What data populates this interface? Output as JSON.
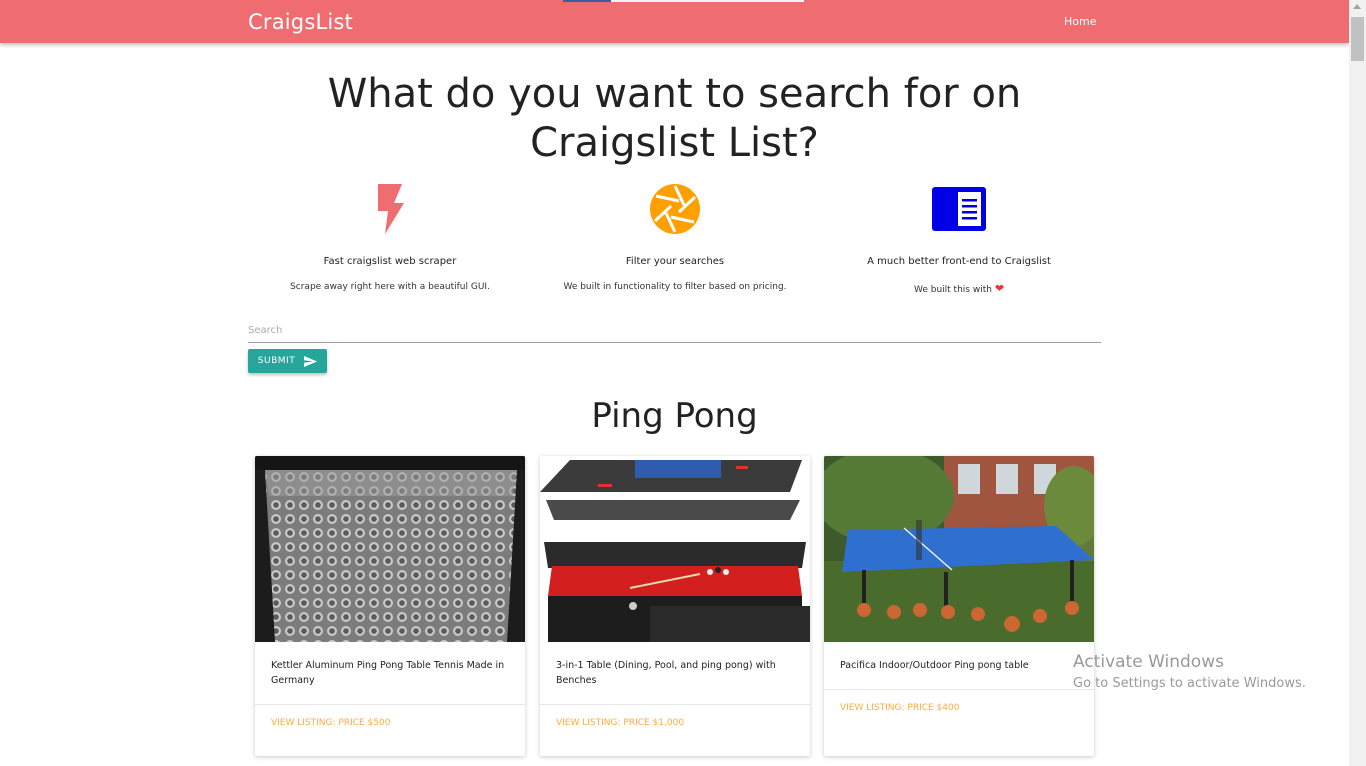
{
  "nav": {
    "brand": "CraigsList",
    "home": "Home"
  },
  "headline": "What do you want to search for on Craigslist List?",
  "features": [
    {
      "icon": "flash-icon",
      "title": "Fast craigslist web scraper",
      "desc": "Scrape away right here with a beautiful GUI."
    },
    {
      "icon": "aperture-icon",
      "title": "Filter your searches",
      "desc": "We built in functionality to filter based on pricing."
    },
    {
      "icon": "chrome-reader-icon",
      "title": "A much better front-end to Craigslist",
      "desc": "We built this with"
    }
  ],
  "search": {
    "placeholder": "Search",
    "value": ""
  },
  "submit": {
    "label": "SUBMIT"
  },
  "section_title": "Ping Pong",
  "listings": [
    {
      "title": "Kettler Aluminum Ping Pong Table Tennis Made in Germany",
      "action": "VIEW LISTING: PRICE $500"
    },
    {
      "title": "3-in-1 Table (Dining, Pool, and ping pong) with Benches",
      "action": "VIEW LISTING: PRICE $1,000"
    },
    {
      "title": "Pacifica Indoor/Outdoor Ping pong table",
      "action": "VIEW LISTING: PRICE $400"
    }
  ],
  "watermark": {
    "title": "Activate Windows",
    "subtitle": "Go to Settings to activate Windows."
  },
  "colors": {
    "nav": "#ef6c71",
    "accent": "#26a69a",
    "action": "#ffab40",
    "aperture": "#ffa000",
    "reader": "#0000e6"
  }
}
